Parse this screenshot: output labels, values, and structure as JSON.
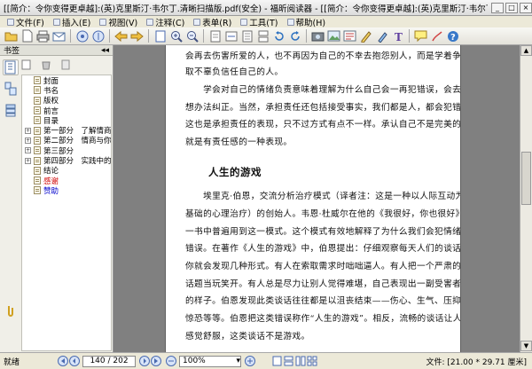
{
  "window": {
    "title": "[[简介：令你变得更卓越]:(英)克里斯汀·韦尔丁.清晰扫描版.pdf(安全) - 福昕阅读器 - [[简介：令你变得更卓越]:(英)克里斯汀·韦尔丁.清晰扫描版.p..."
  },
  "menu": {
    "items": [
      "文件(F)",
      "插入(E)",
      "视图(V)",
      "注释(C)",
      "表单(R)",
      "工具(T)",
      "帮助(H)"
    ]
  },
  "sidebar": {
    "title": "书签",
    "bookmarks": [
      {
        "label": "封面",
        "exp": ""
      },
      {
        "label": "书名",
        "exp": ""
      },
      {
        "label": "版权",
        "exp": ""
      },
      {
        "label": "前言",
        "exp": ""
      },
      {
        "label": "目录",
        "exp": ""
      },
      {
        "label": "第一部分　了解情商",
        "exp": "+"
      },
      {
        "label": "第二部分　情商与你：",
        "exp": "+"
      },
      {
        "label": "第三部分",
        "exp": "+"
      },
      {
        "label": "第四部分　实践中的情",
        "exp": "+"
      },
      {
        "label": "结论",
        "exp": ""
      },
      {
        "label": "感谢",
        "exp": "",
        "style": "red"
      },
      {
        "label": "赞助",
        "exp": "",
        "style": "blue"
      }
    ]
  },
  "document": {
    "lines": [
      {
        "text": "会再去伤害所爱的人，也不再因为自己的不幸去抱怨别人，而是学着争",
        "cls": ""
      },
      {
        "text": "取不辜负信任自己的人。",
        "cls": ""
      },
      {
        "text": "　　学会对自己的情绪负责意味着理解为什么自己会一再犯错误，会去",
        "cls": ""
      },
      {
        "text": "想办法纠正。当然，承担责任还包括接受事实，我们都是人，都会犯错误，",
        "cls": ""
      },
      {
        "text": "这也是承担责任的表现，只不过方式有点不一样。承认自己不是完美的",
        "cls": ""
      },
      {
        "text": "就是有责任感的一种表现。",
        "cls": ""
      },
      {
        "text": "人生的游戏",
        "cls": "h2"
      },
      {
        "text": "　　埃里克·伯恩，交流分析治疗模式（译者注：这是一种以人际互动为",
        "cls": ""
      },
      {
        "text": "基础的心理治疗）的创始人。韦恩·杜威尔在他的《我很好，你也很好》",
        "cls": ""
      },
      {
        "text": "一书中普遍用到这一模式。这个模式有效地解释了为什么我们会犯情绪",
        "cls": ""
      },
      {
        "text": "错误。在著作《人生的游戏》中，伯恩提出：仔细观察每天人们的谈话，",
        "cls": ""
      },
      {
        "text": "你就会发现几种形式。有人在索取需求时咄咄逼人。有人把一个严肃的",
        "cls": ""
      },
      {
        "text": "话题当玩笑开。有人总是尽力让别人觉得难堪，自己表现出一副受害者",
        "cls": ""
      },
      {
        "text": "的样子。伯恩发现此类谈话往往都是以沮丧结束——伤心、生气、压抑、",
        "cls": ""
      },
      {
        "text": "惊恐等等。伯恩把这类错误称作“人生的游戏”。相反，流畅的谈话让人",
        "cls": ""
      },
      {
        "text": "感觉舒服，这类谈话不是游戏。",
        "cls": ""
      }
    ]
  },
  "status": {
    "ready": "就绪",
    "page_display": "140 / 202",
    "zoom": "100%",
    "docsize": "文件: [21.00 * 29.71 厘米]"
  },
  "colors": {
    "bookmark_red": "#d00000",
    "bookmark_blue": "#0000cc"
  }
}
